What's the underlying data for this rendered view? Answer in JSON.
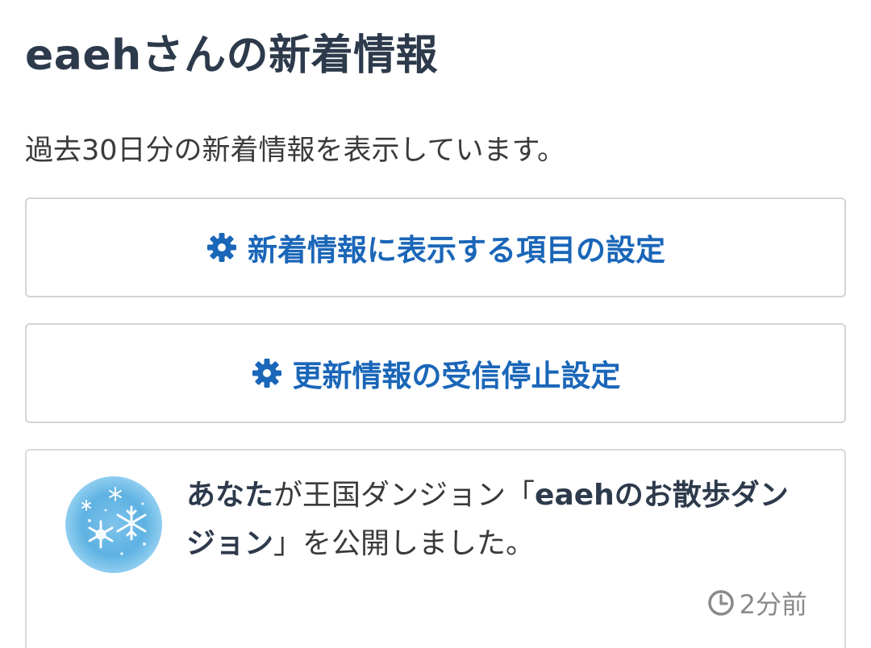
{
  "header": {
    "title": "eaehさんの新着情報",
    "description": "過去30日分の新着情報を表示しています。"
  },
  "buttons": {
    "display_settings": {
      "icon": "gear-icon",
      "label": "新着情報に表示する項目の設定"
    },
    "unsubscribe_settings": {
      "icon": "gear-icon",
      "label": "更新情報の受信停止設定"
    }
  },
  "feed": {
    "items": [
      {
        "avatar_icon": "snowflake-avatar",
        "actor": "あなた",
        "text_part1": "が王国ダンジョン「",
        "dungeon_name": "eaehのお散歩ダンジョン",
        "text_part2": "」を公開しました。",
        "time_icon": "clock-icon",
        "time": "2分前"
      }
    ]
  },
  "colors": {
    "title": "#2d3a4b",
    "accent": "#1a66b8",
    "border": "#d4d4d4",
    "muted": "#8a8a8a"
  }
}
